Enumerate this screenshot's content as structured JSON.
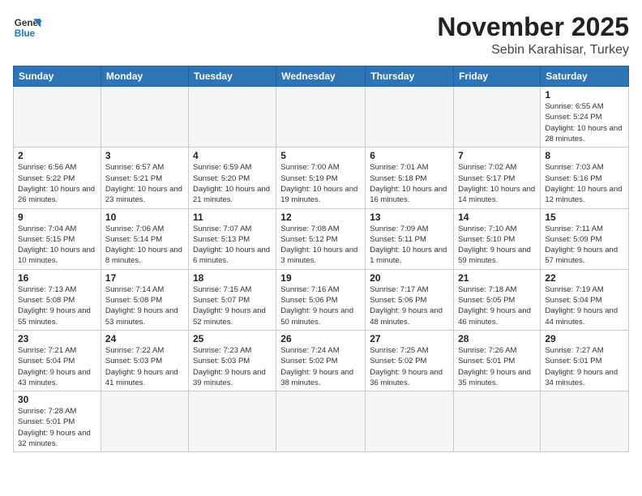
{
  "logo": {
    "line1": "General",
    "line2": "Blue"
  },
  "title": "November 2025",
  "subtitle": "Sebin Karahisar, Turkey",
  "weekdays": [
    "Sunday",
    "Monday",
    "Tuesday",
    "Wednesday",
    "Thursday",
    "Friday",
    "Saturday"
  ],
  "weeks": [
    [
      {
        "day": "",
        "info": ""
      },
      {
        "day": "",
        "info": ""
      },
      {
        "day": "",
        "info": ""
      },
      {
        "day": "",
        "info": ""
      },
      {
        "day": "",
        "info": ""
      },
      {
        "day": "",
        "info": ""
      },
      {
        "day": "1",
        "info": "Sunrise: 6:55 AM\nSunset: 5:24 PM\nDaylight: 10 hours and 28 minutes."
      }
    ],
    [
      {
        "day": "2",
        "info": "Sunrise: 6:56 AM\nSunset: 5:22 PM\nDaylight: 10 hours and 26 minutes."
      },
      {
        "day": "3",
        "info": "Sunrise: 6:57 AM\nSunset: 5:21 PM\nDaylight: 10 hours and 23 minutes."
      },
      {
        "day": "4",
        "info": "Sunrise: 6:59 AM\nSunset: 5:20 PM\nDaylight: 10 hours and 21 minutes."
      },
      {
        "day": "5",
        "info": "Sunrise: 7:00 AM\nSunset: 5:19 PM\nDaylight: 10 hours and 19 minutes."
      },
      {
        "day": "6",
        "info": "Sunrise: 7:01 AM\nSunset: 5:18 PM\nDaylight: 10 hours and 16 minutes."
      },
      {
        "day": "7",
        "info": "Sunrise: 7:02 AM\nSunset: 5:17 PM\nDaylight: 10 hours and 14 minutes."
      },
      {
        "day": "8",
        "info": "Sunrise: 7:03 AM\nSunset: 5:16 PM\nDaylight: 10 hours and 12 minutes."
      }
    ],
    [
      {
        "day": "9",
        "info": "Sunrise: 7:04 AM\nSunset: 5:15 PM\nDaylight: 10 hours and 10 minutes."
      },
      {
        "day": "10",
        "info": "Sunrise: 7:06 AM\nSunset: 5:14 PM\nDaylight: 10 hours and 8 minutes."
      },
      {
        "day": "11",
        "info": "Sunrise: 7:07 AM\nSunset: 5:13 PM\nDaylight: 10 hours and 6 minutes."
      },
      {
        "day": "12",
        "info": "Sunrise: 7:08 AM\nSunset: 5:12 PM\nDaylight: 10 hours and 3 minutes."
      },
      {
        "day": "13",
        "info": "Sunrise: 7:09 AM\nSunset: 5:11 PM\nDaylight: 10 hours and 1 minute."
      },
      {
        "day": "14",
        "info": "Sunrise: 7:10 AM\nSunset: 5:10 PM\nDaylight: 9 hours and 59 minutes."
      },
      {
        "day": "15",
        "info": "Sunrise: 7:11 AM\nSunset: 5:09 PM\nDaylight: 9 hours and 57 minutes."
      }
    ],
    [
      {
        "day": "16",
        "info": "Sunrise: 7:13 AM\nSunset: 5:08 PM\nDaylight: 9 hours and 55 minutes."
      },
      {
        "day": "17",
        "info": "Sunrise: 7:14 AM\nSunset: 5:08 PM\nDaylight: 9 hours and 53 minutes."
      },
      {
        "day": "18",
        "info": "Sunrise: 7:15 AM\nSunset: 5:07 PM\nDaylight: 9 hours and 52 minutes."
      },
      {
        "day": "19",
        "info": "Sunrise: 7:16 AM\nSunset: 5:06 PM\nDaylight: 9 hours and 50 minutes."
      },
      {
        "day": "20",
        "info": "Sunrise: 7:17 AM\nSunset: 5:06 PM\nDaylight: 9 hours and 48 minutes."
      },
      {
        "day": "21",
        "info": "Sunrise: 7:18 AM\nSunset: 5:05 PM\nDaylight: 9 hours and 46 minutes."
      },
      {
        "day": "22",
        "info": "Sunrise: 7:19 AM\nSunset: 5:04 PM\nDaylight: 9 hours and 44 minutes."
      }
    ],
    [
      {
        "day": "23",
        "info": "Sunrise: 7:21 AM\nSunset: 5:04 PM\nDaylight: 9 hours and 43 minutes."
      },
      {
        "day": "24",
        "info": "Sunrise: 7:22 AM\nSunset: 5:03 PM\nDaylight: 9 hours and 41 minutes."
      },
      {
        "day": "25",
        "info": "Sunrise: 7:23 AM\nSunset: 5:03 PM\nDaylight: 9 hours and 39 minutes."
      },
      {
        "day": "26",
        "info": "Sunrise: 7:24 AM\nSunset: 5:02 PM\nDaylight: 9 hours and 38 minutes."
      },
      {
        "day": "27",
        "info": "Sunrise: 7:25 AM\nSunset: 5:02 PM\nDaylight: 9 hours and 36 minutes."
      },
      {
        "day": "28",
        "info": "Sunrise: 7:26 AM\nSunset: 5:01 PM\nDaylight: 9 hours and 35 minutes."
      },
      {
        "day": "29",
        "info": "Sunrise: 7:27 AM\nSunset: 5:01 PM\nDaylight: 9 hours and 34 minutes."
      }
    ],
    [
      {
        "day": "30",
        "info": "Sunrise: 7:28 AM\nSunset: 5:01 PM\nDaylight: 9 hours and 32 minutes."
      },
      {
        "day": "",
        "info": ""
      },
      {
        "day": "",
        "info": ""
      },
      {
        "day": "",
        "info": ""
      },
      {
        "day": "",
        "info": ""
      },
      {
        "day": "",
        "info": ""
      },
      {
        "day": "",
        "info": ""
      }
    ]
  ]
}
